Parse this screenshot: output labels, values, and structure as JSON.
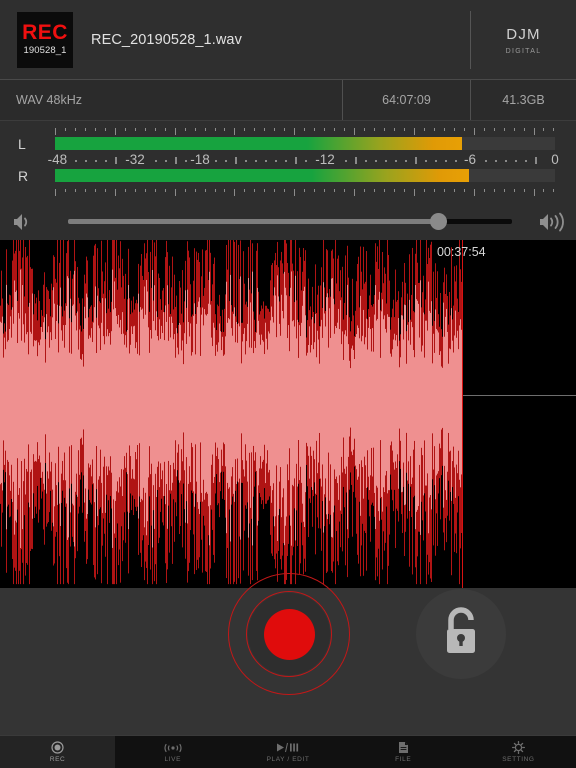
{
  "header": {
    "badge": {
      "title": "REC",
      "subtitle": "190528_1",
      "icon": "record-badge-icon"
    },
    "filename": "REC_20190528_1.wav",
    "brand": {
      "name": "DJM",
      "tagline": "DIGITAL"
    }
  },
  "info_bar": {
    "format": "WAV 48kHz",
    "remaining_time": "64:07:09",
    "free_space": "41.3GB"
  },
  "meters": {
    "left_label": "L",
    "right_label": "R",
    "left_level_pct": 81.4,
    "right_level_pct": 82.8,
    "scale_labels": [
      "-48",
      "-32",
      "-18",
      "-12",
      "-6",
      "0"
    ],
    "scale_positions_pct": [
      0,
      16,
      29,
      54,
      83,
      100
    ],
    "colors": {
      "green": "#17a33f",
      "yellow": "#9aa31e",
      "amber": "#e09a06",
      "track": "#3a3a3a"
    }
  },
  "volume": {
    "low_icon": "speaker-low-icon",
    "high_icon": "speaker-high-icon",
    "value_pct": 85
  },
  "waveform": {
    "timestamp": "00:37:54",
    "playhead_pct": 80.2,
    "colors": {
      "background": "#000000",
      "outline": "#b01414",
      "fill": "#ef9090",
      "playhead": "#d81212",
      "centerline": "#6e6e6e"
    }
  },
  "controls": {
    "record_button": {
      "name": "record-button",
      "color": "#e00c0c"
    },
    "lock_button": {
      "name": "lock-button",
      "icon": "unlocked-padlock-icon"
    }
  },
  "tabs": [
    {
      "label": "REC",
      "icon": "record-dot-icon",
      "active": true
    },
    {
      "label": "LIVE",
      "icon": "broadcast-icon",
      "active": false
    },
    {
      "label": "PLAY / EDIT",
      "icon": "play-pause-icon",
      "active": false
    },
    {
      "label": "FILE",
      "icon": "file-icon",
      "active": false
    },
    {
      "label": "SETTING",
      "icon": "gear-icon",
      "active": false
    }
  ]
}
